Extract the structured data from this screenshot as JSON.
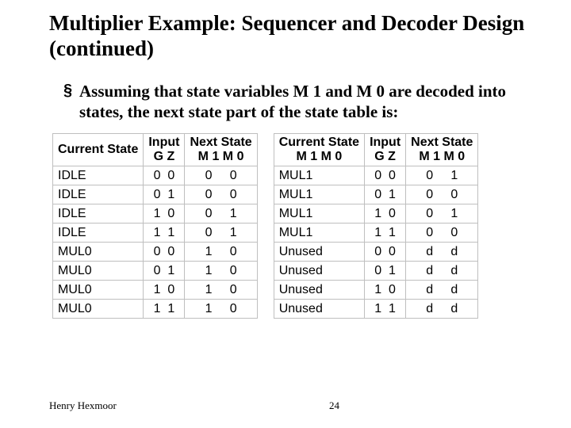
{
  "title": "Multiplier Example: Sequencer and Decoder Design (continued)",
  "bullet_text": "Assuming that state variables M 1 and M 0 are decoded into states, the next state part of the state table is:",
  "headers": {
    "current_state": "Current State",
    "input": "Input",
    "next_state": "Next State",
    "gz": "G  Z",
    "m1m0": "M 1  M 0"
  },
  "left_rows": [
    {
      "state": "IDLE",
      "gz": "0  0",
      "ns": "0     0"
    },
    {
      "state": "IDLE",
      "gz": "0  1",
      "ns": "0     0"
    },
    {
      "state": "IDLE",
      "gz": "1  0",
      "ns": "0     1"
    },
    {
      "state": "IDLE",
      "gz": "1  1",
      "ns": "0     1"
    },
    {
      "state": "MUL0",
      "gz": "0  0",
      "ns": "1     0"
    },
    {
      "state": "MUL0",
      "gz": "0  1",
      "ns": "1     0"
    },
    {
      "state": "MUL0",
      "gz": "1  0",
      "ns": "1     0"
    },
    {
      "state": "MUL0",
      "gz": "1  1",
      "ns": "1     0"
    }
  ],
  "right_rows": [
    {
      "state": "MUL1",
      "gz": "0  0",
      "ns": "0     1"
    },
    {
      "state": "MUL1",
      "gz": "0  1",
      "ns": "0     0"
    },
    {
      "state": "MUL1",
      "gz": "1  0",
      "ns": "0     1"
    },
    {
      "state": "MUL1",
      "gz": "1  1",
      "ns": "0     0"
    },
    {
      "state": "Unused",
      "gz": "0  0",
      "ns": "d     d"
    },
    {
      "state": "Unused",
      "gz": "0  1",
      "ns": "d     d"
    },
    {
      "state": "Unused",
      "gz": "1  0",
      "ns": "d     d"
    },
    {
      "state": "Unused",
      "gz": "1  1",
      "ns": "d     d"
    }
  ],
  "footer": {
    "author": "Henry Hexmoor",
    "page": "24"
  },
  "chart_data": {
    "type": "table",
    "title": "Next-state part of the state table (M1 M0 encoding)",
    "columns": [
      "Current State",
      "Input G",
      "Input Z",
      "Next State M1",
      "Next State M0"
    ],
    "rows": [
      [
        "IDLE",
        0,
        0,
        0,
        0
      ],
      [
        "IDLE",
        0,
        1,
        0,
        0
      ],
      [
        "IDLE",
        1,
        0,
        0,
        1
      ],
      [
        "IDLE",
        1,
        1,
        0,
        1
      ],
      [
        "MUL0",
        0,
        0,
        1,
        0
      ],
      [
        "MUL0",
        0,
        1,
        1,
        0
      ],
      [
        "MUL0",
        1,
        0,
        1,
        0
      ],
      [
        "MUL0",
        1,
        1,
        1,
        0
      ],
      [
        "MUL1",
        0,
        0,
        0,
        1
      ],
      [
        "MUL1",
        0,
        1,
        0,
        0
      ],
      [
        "MUL1",
        1,
        0,
        0,
        1
      ],
      [
        "MUL1",
        1,
        1,
        0,
        0
      ],
      [
        "Unused",
        0,
        0,
        "d",
        "d"
      ],
      [
        "Unused",
        0,
        1,
        "d",
        "d"
      ],
      [
        "Unused",
        1,
        0,
        "d",
        "d"
      ],
      [
        "Unused",
        1,
        1,
        "d",
        "d"
      ]
    ]
  }
}
